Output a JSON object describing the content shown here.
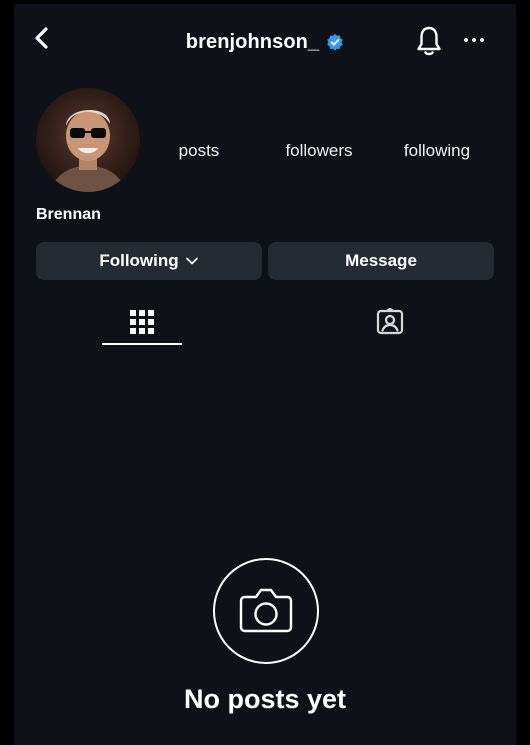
{
  "header": {
    "username": "brenjohnson_",
    "verified": true,
    "icons": [
      "back-chevron-icon",
      "verified-badge-icon",
      "bell-icon",
      "more-dots-icon"
    ]
  },
  "profile": {
    "display_name": "Brennan",
    "stats": {
      "posts_label": "posts",
      "followers_label": "followers",
      "following_label": "following"
    }
  },
  "actions": {
    "following_label": "Following",
    "message_label": "Message"
  },
  "tabs": [
    {
      "icon": "grid-icon",
      "selected": true
    },
    {
      "icon": "tagged-person-icon",
      "selected": false
    }
  ],
  "empty_state": {
    "icon": "camera-icon",
    "text": "No posts yet"
  },
  "colors": {
    "background": "#0e1117",
    "button_bg": "#262a33",
    "verified_blue": "#3897f0",
    "text": "#ffffff"
  }
}
